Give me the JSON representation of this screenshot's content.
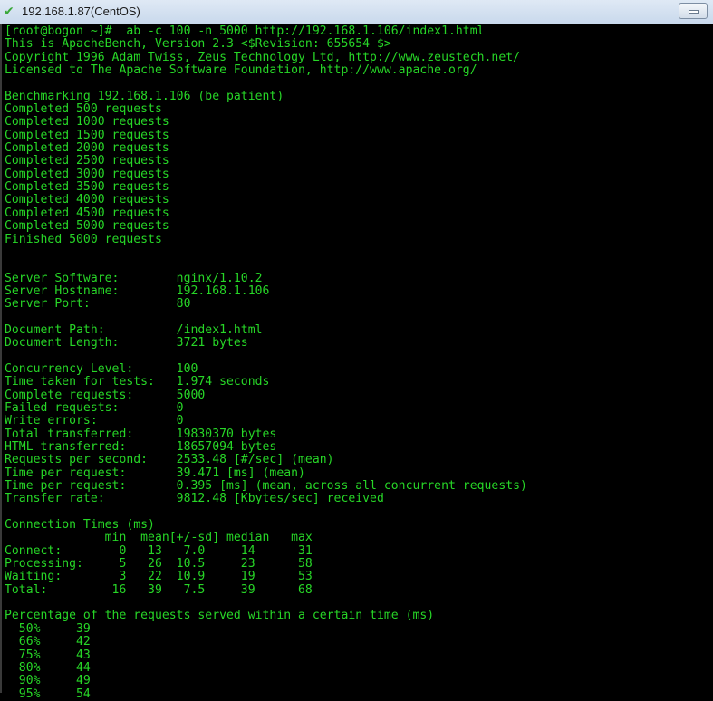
{
  "window": {
    "title": "192.168.1.87(CentOS)",
    "status_icon": "check-icon",
    "minimize_icon": "minimize-icon"
  },
  "colors": {
    "terminal_bg": "#000000",
    "terminal_fg": "#27d627"
  },
  "terminal": {
    "lines": [
      "[root@bogon ~]#  ab -c 100 -n 5000 http://192.168.1.106/index1.html",
      "This is ApacheBench, Version 2.3 <$Revision: 655654 $>",
      "Copyright 1996 Adam Twiss, Zeus Technology Ltd, http://www.zeustech.net/",
      "Licensed to The Apache Software Foundation, http://www.apache.org/",
      "",
      "Benchmarking 192.168.1.106 (be patient)",
      "Completed 500 requests",
      "Completed 1000 requests",
      "Completed 1500 requests",
      "Completed 2000 requests",
      "Completed 2500 requests",
      "Completed 3000 requests",
      "Completed 3500 requests",
      "Completed 4000 requests",
      "Completed 4500 requests",
      "Completed 5000 requests",
      "Finished 5000 requests",
      "",
      "",
      "Server Software:        nginx/1.10.2",
      "Server Hostname:        192.168.1.106",
      "Server Port:            80",
      "",
      "Document Path:          /index1.html",
      "Document Length:        3721 bytes",
      "",
      "Concurrency Level:      100",
      "Time taken for tests:   1.974 seconds",
      "Complete requests:      5000",
      "Failed requests:        0",
      "Write errors:           0",
      "Total transferred:      19830370 bytes",
      "HTML transferred:       18657094 bytes",
      "Requests per second:    2533.48 [#/sec] (mean)",
      "Time per request:       39.471 [ms] (mean)",
      "Time per request:       0.395 [ms] (mean, across all concurrent requests)",
      "Transfer rate:          9812.48 [Kbytes/sec] received",
      "",
      "Connection Times (ms)",
      "              min  mean[+/-sd] median   max",
      "Connect:        0   13   7.0     14      31",
      "Processing:     5   26  10.5     23      58",
      "Waiting:        3   22  10.9     19      53",
      "Total:         16   39   7.5     39      68",
      "",
      "Percentage of the requests served within a certain time (ms)",
      "  50%     39",
      "  66%     42",
      "  75%     43",
      "  80%     44",
      "  90%     49",
      "  95%     54"
    ]
  }
}
